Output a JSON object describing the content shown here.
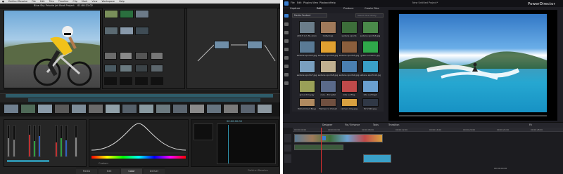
{
  "resolve": {
    "app_name": "DaVinci Resolve",
    "menu": [
      "DaVinci Resolve",
      "File",
      "Edit",
      "Trim",
      "Timeline",
      "Clip",
      "Mark",
      "View",
      "Workspace",
      "Help"
    ],
    "viewer_title": "Blue Sky Private Jet Boat Project",
    "timecode": "01:00:21:02",
    "tabs": [
      "Media",
      "Edit",
      "Color",
      "Deliver"
    ],
    "grading_label": "Custom",
    "viewer_chip": "00:00:00:00",
    "brand_footer": "DaVinci Resolve"
  },
  "powerdirector": {
    "title": "PowerDirector",
    "window_caption": "New Untitled Project*",
    "menu": [
      "File",
      "Edit",
      "Plugins",
      "View",
      "Playback",
      "Help"
    ],
    "tabs": [
      "Capture",
      "Edit",
      "Produce",
      "Create Disc"
    ],
    "library_filter": "Media Content",
    "search_placeholder": "Search the library",
    "media_items": [
      "ADS3 1.2_TA_Gran",
      "Cat&dogs",
      "sadane sports",
      "sadane sports6.jpg",
      "sadane sports3.jpg",
      "sadane sports4.jpg",
      "sadane sports5.jpg",
      "green screen1.jpg",
      "sadane sports7.jpg",
      "sadane sports8.jpg",
      "sadane sports9.jpg",
      "sadane sports10.jpg",
      "groundmaygy",
      "cars...3Crystal",
      "kite surfing",
      "kite surfing4",
      "Mohammed Baye",
      "Flamenco Chinell",
      "camera Dog.jpg",
      "PV 2019.jpg"
    ],
    "toolbar_items": [
      "Designer",
      "Fix / Enhance",
      "Tools",
      "Transition"
    ],
    "timeline_times": [
      "00:00:00:00",
      "00:00:04:00",
      "00:00:08:00",
      "00:00:12:00",
      "00:00:16:00",
      "00:00:20:00",
      "00:00:24:00",
      "00:00:28:00"
    ],
    "fit_label": "Fit",
    "playback_time": "00:00:00:00"
  },
  "colors": {
    "resolve_bg": "#232323",
    "resolve_accent": "#2e8fa8",
    "pd_bg": "#1e1e24",
    "pd_accent": "#3a7fd0",
    "playhead": "#e03030"
  }
}
